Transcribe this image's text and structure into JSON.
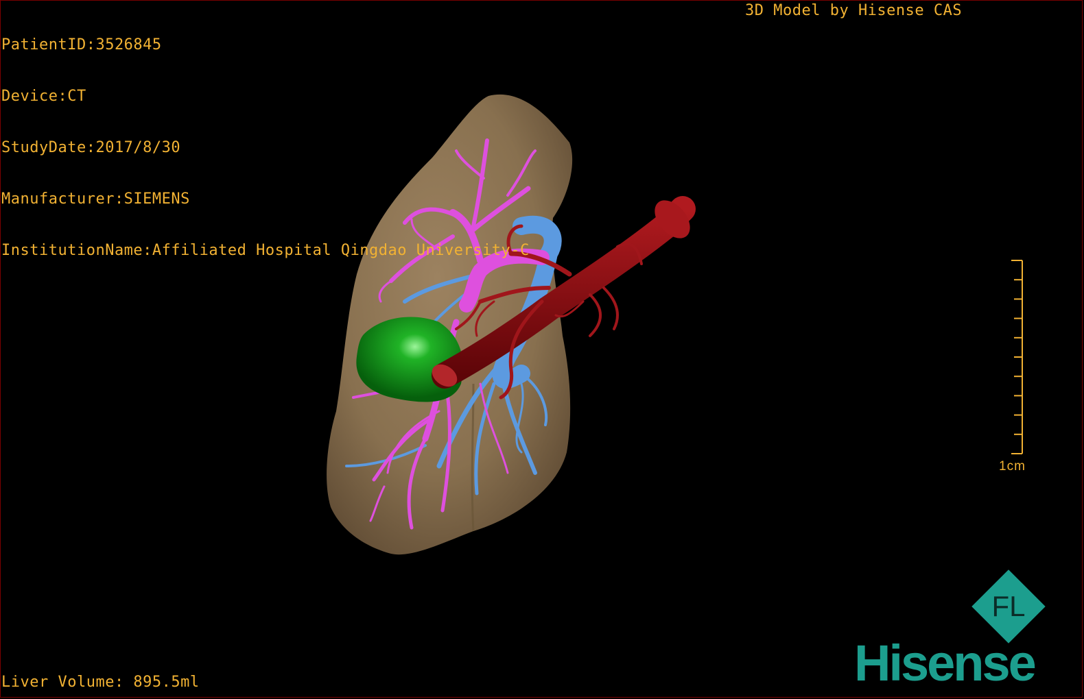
{
  "header": {
    "patient_id": "PatientID:3526845",
    "device": "Device:CT",
    "study_date": "StudyDate:2017/8/30",
    "manufacturer": "Manufacturer:SIEMENS",
    "institution": "InstitutionName:Affiliated Hospital Qingdao University-C"
  },
  "watermark_text": "3D Model by Hisense CAS",
  "footer": {
    "liver_volume": "Liver Volume: 895.5ml"
  },
  "scale_bar": {
    "label": "1cm",
    "ticks": 10
  },
  "logo": {
    "badge_text": "FL",
    "brand": "Hisense"
  },
  "colors": {
    "overlay_text": "#f2b233",
    "liver": "#8c7352",
    "portal_vein": "#d94ad9",
    "hepatic_vein": "#4f8fd8",
    "artery": "#8a0c10",
    "tumor": "#0f9a1a",
    "brand": "#1c9e8e"
  }
}
